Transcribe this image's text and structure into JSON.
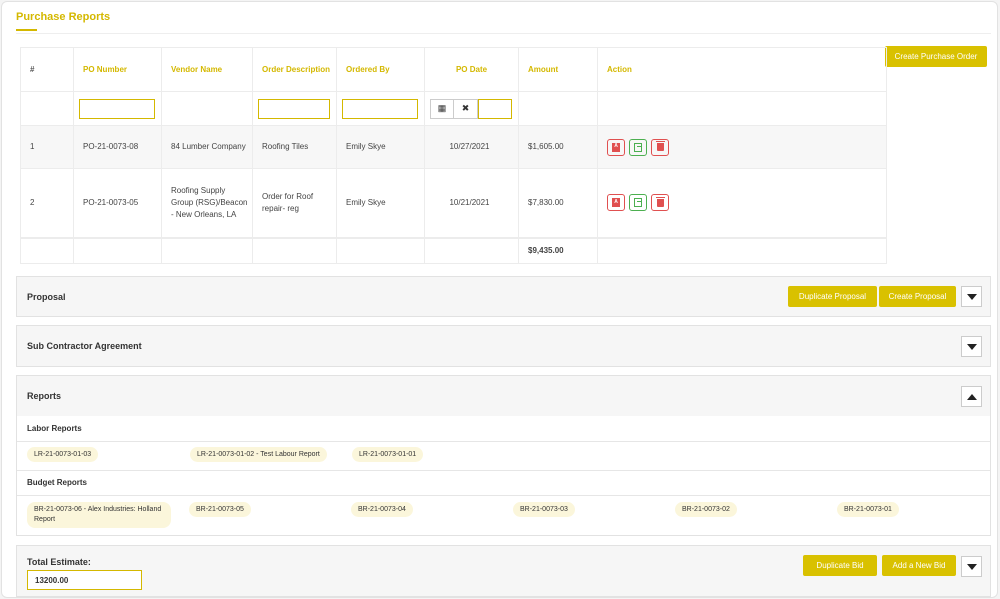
{
  "page": {
    "title": "Purchase Reports"
  },
  "purchase": {
    "create_button": "Create Purchase Order",
    "columns": [
      "#",
      "PO Number",
      "Vendor Name",
      "Order Description",
      "Ordered By",
      "PO Date",
      "Amount",
      "Action"
    ],
    "rows": [
      {
        "num": "1",
        "po_number": "PO-21-0073-08",
        "vendor": "84 Lumber Company",
        "description": "Roofing Tiles",
        "ordered_by": "Emily Skye",
        "po_date": "10/27/2021",
        "amount": "$1,605.00"
      },
      {
        "num": "2",
        "po_number": "PO-21-0073-05",
        "vendor": "Roofing Supply Group (RSG)/Beacon - New Orleans, LA",
        "description": "Order for Roof repair- reg",
        "ordered_by": "Emily Skye",
        "po_date": "10/21/2021",
        "amount": "$7,830.00"
      }
    ],
    "total_amount": "$9,435.00",
    "icons": {
      "calendar": "calendar-icon",
      "clear": "clear-x-icon",
      "pdf": "pdf-icon",
      "copy": "copy-icon",
      "delete": "trash-icon"
    }
  },
  "proposal": {
    "title": "Proposal",
    "duplicate_button": "Duplicate Proposal",
    "create_button": "Create Proposal"
  },
  "subcontractor": {
    "title": "Sub Contractor Agreement"
  },
  "reports": {
    "title": "Reports",
    "labor_title": "Labor Reports",
    "labor_items": [
      "LR-21-0073-01-03",
      "LR-21-0073-01-02 - Test Labour Report",
      "LR-21-0073-01-01"
    ],
    "budget_title": "Budget Reports",
    "budget_items": [
      "BR-21-0073-06 - Alex Industries: Holland Report",
      "BR-21-0073-05",
      "BR-21-0073-04",
      "BR-21-0073-03",
      "BR-21-0073-02",
      "BR-21-0073-01"
    ]
  },
  "estimate": {
    "label": "Total Estimate:",
    "value": "13200.00",
    "duplicate_button": "Duplicate Bid",
    "add_button": "Add a New Bid"
  },
  "colors": {
    "accent": "#d9c100",
    "danger": "#e05050",
    "success": "#4caf50"
  }
}
